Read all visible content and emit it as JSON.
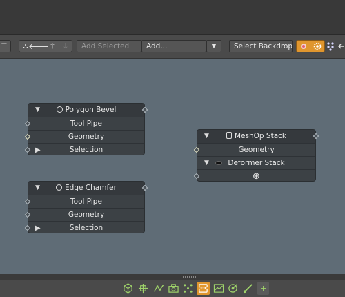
{
  "toolbar": {
    "menu_glyph": "☰",
    "arrange_glyph": "⛬",
    "left_glyph": "🡐",
    "up_glyph": "🡑",
    "down_glyph": "🡓",
    "add_selected_placeholder": "Add Selected",
    "add_value": "Add...",
    "dropdown_glyph": "▼",
    "select_backdrop_label": "Select Backdrop",
    "accent_color": "#e0962e"
  },
  "nodes": {
    "polygon_bevel": {
      "title": "Polygon Bevel",
      "rows": [
        "Tool Pipe",
        "Geometry",
        "Selection"
      ]
    },
    "edge_chamfer": {
      "title": "Edge Chamfer",
      "rows": [
        "Tool Pipe",
        "Geometry",
        "Selection"
      ]
    },
    "meshop_stack": {
      "title": "MeshOp Stack",
      "rows": [
        "Geometry",
        "Deformer Stack"
      ],
      "add_glyph": "⊕"
    }
  },
  "bottombar": {
    "icons": [
      "cube-icon",
      "transform-icon",
      "graph-icon",
      "camera-icon",
      "dots-icon",
      "schematic-icon",
      "chart-icon",
      "target-icon",
      "pen-icon",
      "add-icon"
    ],
    "active_icon": "schematic-icon"
  }
}
